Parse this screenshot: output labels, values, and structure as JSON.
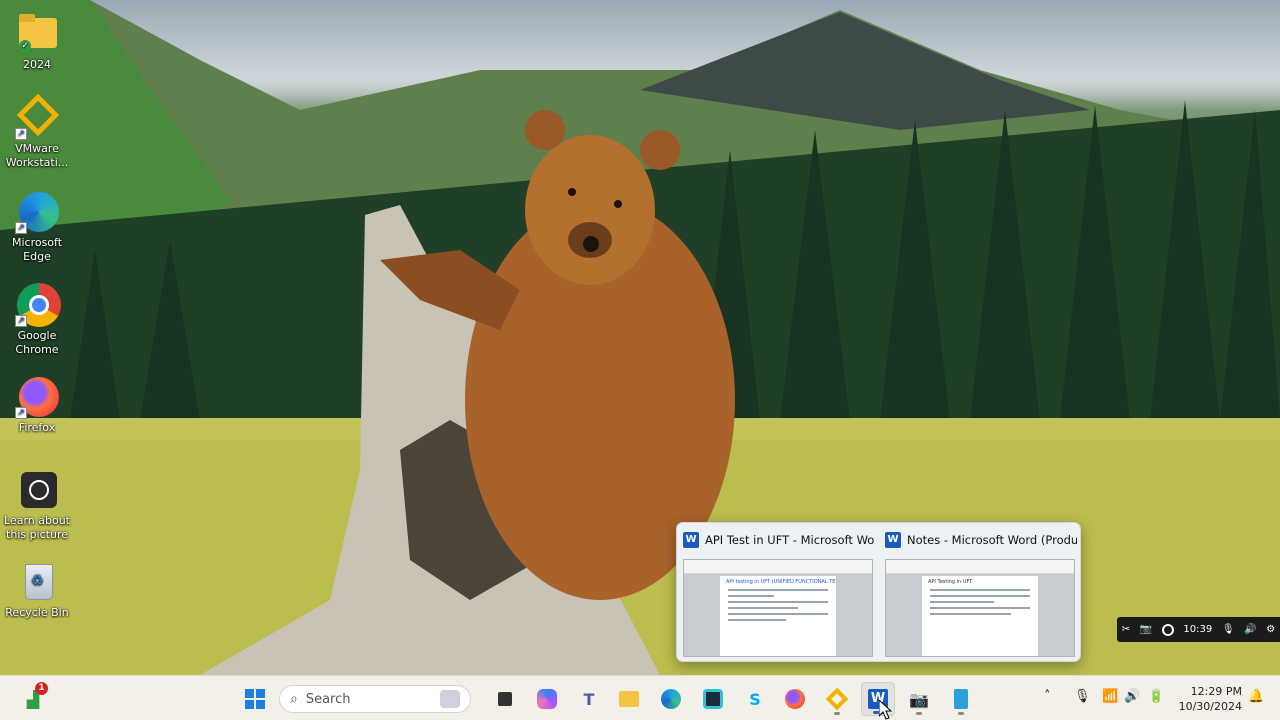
{
  "desktop": {
    "icons": [
      {
        "label": "2024",
        "icon": "folder-icon"
      },
      {
        "label": "VMware Workstati...",
        "icon": "vmware-icon"
      },
      {
        "label": "Microsoft Edge",
        "icon": "edge-icon"
      },
      {
        "label": "Google Chrome",
        "icon": "chrome-icon"
      },
      {
        "label": "Firefox",
        "icon": "firefox-icon"
      },
      {
        "label": "Learn about this picture",
        "icon": "camera-icon"
      },
      {
        "label": "Recycle Bin",
        "icon": "recycle-bin-icon"
      }
    ]
  },
  "thumbnails": [
    {
      "title": "API Test in UFT - Microsoft Wor...",
      "app_icon": "word-icon",
      "doc_heading": "API testing in UFT (UNIFIED FUNCTIONAL TESTING)"
    },
    {
      "title": "Notes - Microsoft Word (Produ...",
      "app_icon": "word-icon",
      "doc_heading": "API Testing in UFT"
    }
  ],
  "recorder": {
    "time": "10:39"
  },
  "taskbar": {
    "widgets_badge": "1",
    "search_placeholder": "Search",
    "apps": [
      "windows-start-icon",
      "task-view-icon",
      "copilot-icon",
      "teams-icon",
      "file-explorer-icon",
      "edge-icon",
      "alexa-icon",
      "skype-icon",
      "firefox-icon",
      "vmware-icon",
      "word-icon",
      "camera-icon",
      "notepad-icon"
    ],
    "tray": {
      "time": "12:29 PM",
      "date": "10/30/2024"
    }
  },
  "colors": {
    "word_blue": "#185abd",
    "accent_red": "#d42020",
    "taskbar_bg": "#f2f0e8"
  }
}
